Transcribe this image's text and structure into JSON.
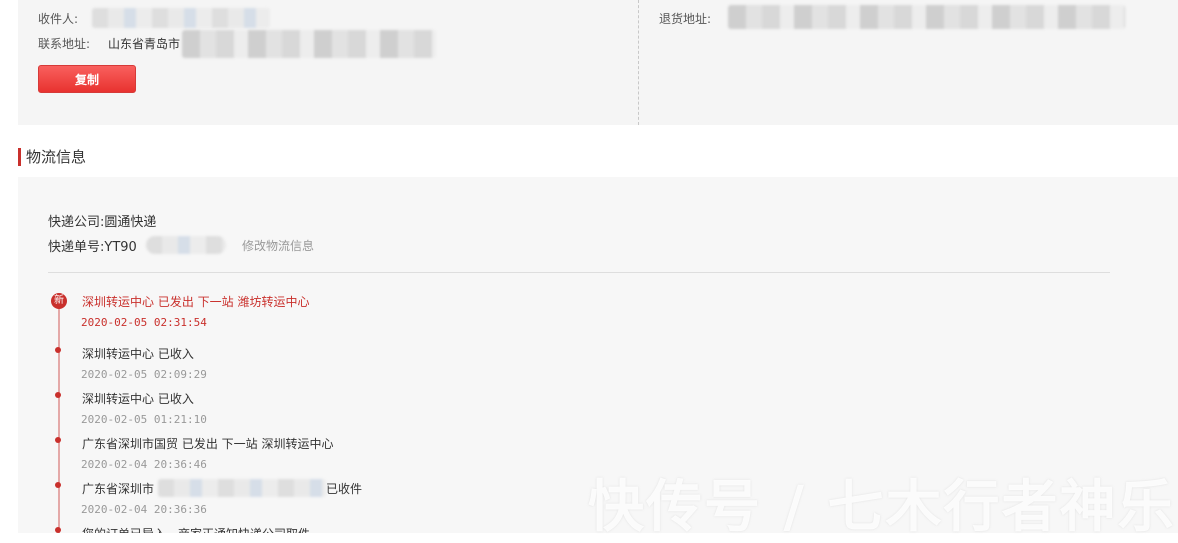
{
  "contact": {
    "recipient_label": "收件人:",
    "address_label": "联系地址:",
    "address_value": "山东省青岛市",
    "copy_button": "复制",
    "return_address_label": "退货地址:"
  },
  "logistics": {
    "section_title": "物流信息",
    "company_label": "快递公司:",
    "company_value": "圆通快递",
    "tracking_label": "快递单号:",
    "tracking_value": "YT90",
    "edit_link": "修改物流信息",
    "new_badge": "新",
    "events": [
      {
        "text": "深圳转运中心 已发出 下一站 潍坊转运中心",
        "time": "2020-02-05 02:31:54"
      },
      {
        "text": "深圳转运中心 已收入",
        "time": "2020-02-05 02:09:29"
      },
      {
        "text": "深圳转运中心 已收入",
        "time": "2020-02-05 01:21:10"
      },
      {
        "text": "广东省深圳市国贸 已发出 下一站 深圳转运中心",
        "time": "2020-02-04 20:36:46"
      },
      {
        "text": "广东省深圳市",
        "text_suffix": "已收件",
        "time": "2020-02-04 20:36:36"
      },
      {
        "text": "您的订单已导入，商家正通知快递公司取件"
      }
    ]
  },
  "watermark": "快传号 / 七木行者神乐",
  "colors": {
    "accent": "#c9302c",
    "button": "#f0403c"
  }
}
